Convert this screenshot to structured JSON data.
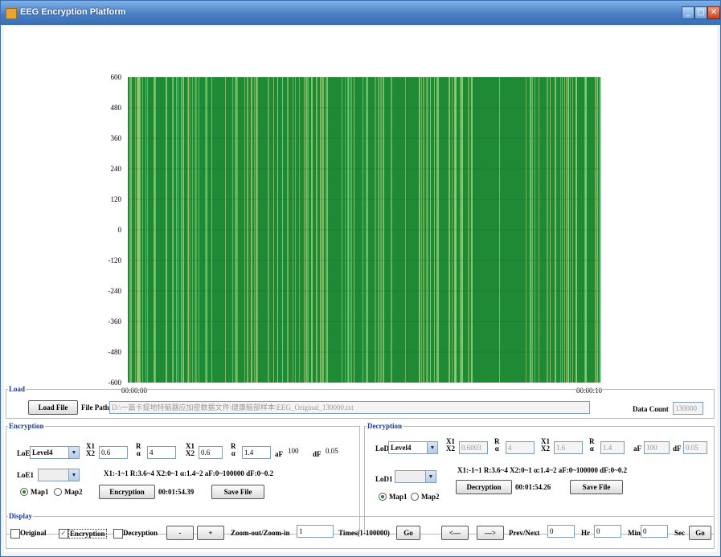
{
  "window": {
    "title": "EEG Encryption Platform",
    "minimize": "_",
    "maximize": "□",
    "close": "✕"
  },
  "chart_data": {
    "type": "bar",
    "color": "#1e8a36",
    "stripe_color": "#9acd73",
    "y_ticks": [
      "600",
      "480",
      "360",
      "240",
      "120",
      "0",
      "-120",
      "-240",
      "-360",
      "-480",
      "-600"
    ],
    "ylim": [
      -600,
      600
    ],
    "x_ticks": [
      "00:00:00",
      "00:00:10"
    ],
    "xlabel": "",
    "ylabel": ""
  },
  "load": {
    "legend": "Load",
    "load_button": "Load File",
    "file_path_label": "File Path",
    "file_path": "D:\\一篇卡提地特脑器应加密数据文件\\健康脑部样本\\EEG_Original_130000.txt",
    "data_count_label": "Data Count",
    "data_count": "130000"
  },
  "encryption": {
    "legend": "Encryption",
    "lod_label": "LoE",
    "level": "Level4",
    "x1x2_label": [
      "X1",
      "X2"
    ],
    "x1x2_value": "0.6",
    "ra_label": [
      "R",
      "α"
    ],
    "ra_value": "4",
    "x1x2b_value": "0.6",
    "rab_value": "1.4",
    "af_label": "aF",
    "af_value": "100",
    "df_label": "dF",
    "df_value": "0.05",
    "loe1_label": "LoE1",
    "ranges": "X1:-1~1  R:3.6~4  X2:0~1  α:1.4~2   aF:0~100000   dF:0~0.2",
    "map1": "Map1",
    "map2": "Map2",
    "action_button": "Encryption",
    "time": "00:01:54.39",
    "save_button": "Save File"
  },
  "decryption": {
    "legend": "Decryption",
    "lod_label": "LoD",
    "level": "Level4",
    "x1x2_label": [
      "X1",
      "X2"
    ],
    "x1x2_value": "0.6003",
    "ra_label": [
      "R",
      "α"
    ],
    "ra_value": "4",
    "x1x2b_value": "1.6",
    "rab_value": "1.4",
    "af_label": "aF",
    "af_value": "100",
    "df_label": "dF",
    "df_value": "0.05",
    "lod1_label": "LoD1",
    "ranges": "X1:-1~1  R:3.6~4  X2:0~1  α:1.4~2   aF:0~100000   dF:0~0.2",
    "map1": "Map1",
    "map2": "Map2",
    "action_button": "Decryption",
    "time": "00:01:54.26",
    "save_button": "Save File"
  },
  "display": {
    "legend": "Display",
    "original": "Original",
    "encryption": "Encryption",
    "decryption": "Decryption",
    "zoom_out": "-",
    "zoom_in": "+",
    "zoom_label": "Zoom-out/Zoom-in",
    "times_value": "1",
    "times_label": "Times(1-100000)",
    "go1": "Go",
    "prev": "<—",
    "next": "—>",
    "prevnext_label": "Prev/Next",
    "hr_value": "0",
    "hr_label": "Hr",
    "min_value": "0",
    "min_label": "Min",
    "sec_value": "0",
    "sec_label": "Sec",
    "go2": "Go"
  }
}
